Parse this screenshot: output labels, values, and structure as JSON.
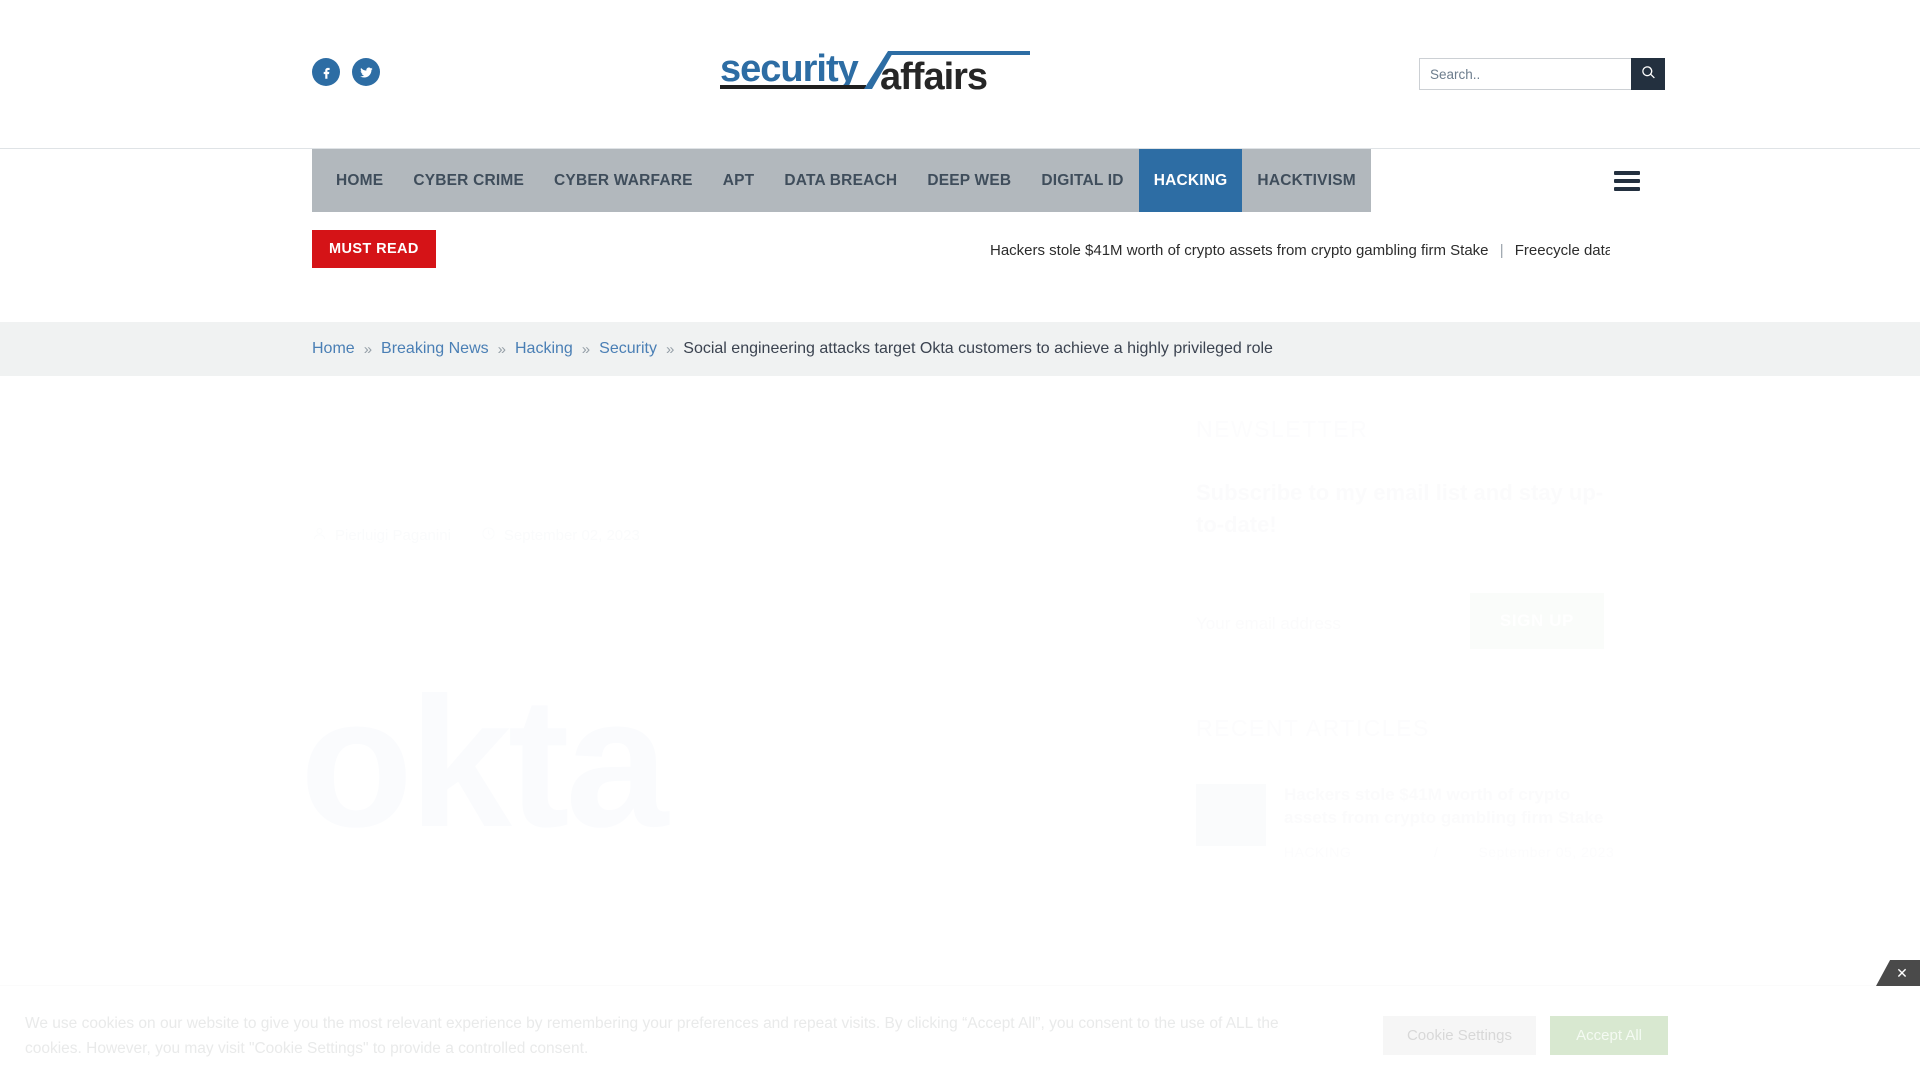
{
  "site": {
    "name": "Security Affairs",
    "logo_primary": "security",
    "logo_secondary": "affairs",
    "brand_blue": "#2d6da4",
    "brand_dark": "#23303f"
  },
  "header": {
    "social": [
      {
        "name": "facebook-icon",
        "label": "Facebook"
      },
      {
        "name": "twitter-icon",
        "label": "Twitter"
      }
    ],
    "search": {
      "placeholder": "Search..",
      "value": "",
      "button_icon": "search-icon"
    }
  },
  "nav": {
    "items": [
      {
        "label": "HOME",
        "active": false
      },
      {
        "label": "CYBER CRIME",
        "active": false
      },
      {
        "label": "CYBER WARFARE",
        "active": false
      },
      {
        "label": "APT",
        "active": false
      },
      {
        "label": "DATA BREACH",
        "active": false
      },
      {
        "label": "DEEP WEB",
        "active": false
      },
      {
        "label": "DIGITAL ID",
        "active": false
      },
      {
        "label": "HACKING",
        "active": true
      },
      {
        "label": "HACKTIVISM",
        "active": false
      }
    ],
    "menu_icon": "hamburger-icon",
    "active_bg": "#2d6da4",
    "bar_bg": "#b2b8bd"
  },
  "ticker": {
    "badge": "MUST READ",
    "badge_color": "#d51317",
    "items": [
      "Hackers stole $41M worth of crypto assets from crypto gambling firm Stake",
      "Freecycle data"
    ],
    "separator": "|"
  },
  "breadcrumb": {
    "separator": "»",
    "links": [
      "Home",
      "Breaking News",
      "Hacking",
      "Security"
    ],
    "current": "Social engineering attacks target Okta customers to achieve a highly privileged role"
  },
  "article": {
    "title": "Social engineering attacks target Okta customers to achieve a highly privileged role",
    "author": "Pierluigi Paganini",
    "date": "September 02, 2023",
    "author_icon": "user-icon",
    "date_icon": "clock-icon",
    "hero_wordmark": "okta"
  },
  "sidebar": {
    "newsletter": {
      "heading": "NEWSLETTER",
      "subheading": "Subscribe to my email list and stay up-to-date!",
      "email_placeholder": "Your email address",
      "email_value": "",
      "signup_label": "SIGN UP"
    },
    "recent": {
      "heading": "RECENT ARTICLES",
      "items": [
        {
          "title": "Hackers stole $41M worth of crypto assets from crypto gambling firm Stake",
          "category": "HACKING",
          "separator": "/",
          "date": "September 05, 2023"
        }
      ]
    }
  },
  "cookie": {
    "text": "We use cookies on our website to give you the most relevant experience by remembering your preferences and repeat visits. By clicking “Accept All”, you consent to the use of ALL the cookies. However, you may visit \"Cookie Settings\" to provide a controlled consent.",
    "settings_label": "Cookie Settings",
    "accept_label": "Accept All",
    "close_label": "✕"
  }
}
